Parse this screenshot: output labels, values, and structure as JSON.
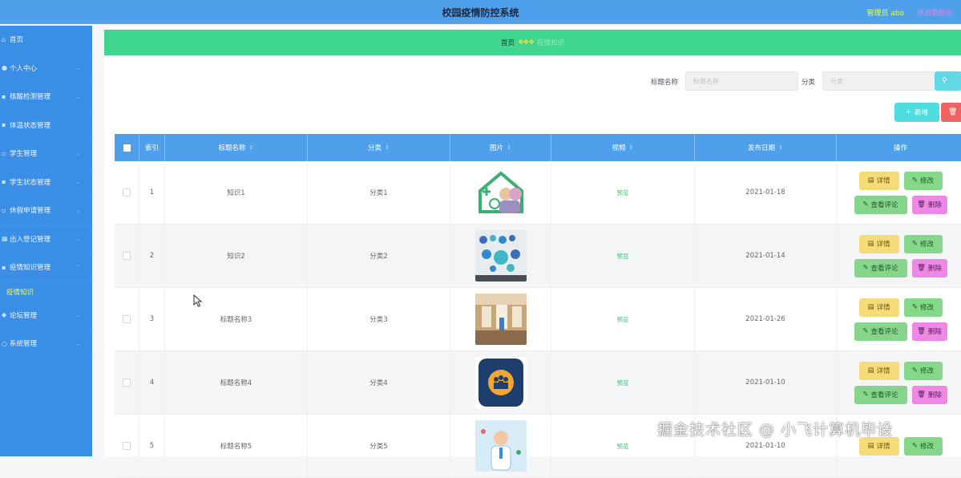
{
  "header": {
    "title": "校园疫情防控系统",
    "admin": "管理员 abo",
    "logout": "退出到前台"
  },
  "sidebar": {
    "items": [
      {
        "label": "首页",
        "icon": "home-icon",
        "expandable": false
      },
      {
        "label": "个人中心",
        "icon": "user-icon",
        "expandable": true
      },
      {
        "label": "核酸检测管理",
        "icon": "flask-icon",
        "expandable": true
      },
      {
        "label": "体温状态管理",
        "icon": "thermometer-icon",
        "expandable": false
      },
      {
        "label": "学生管理",
        "icon": "student-icon",
        "expandable": true
      },
      {
        "label": "学生状态管理",
        "icon": "status-icon",
        "expandable": true
      },
      {
        "label": "休假申请管理",
        "icon": "leave-icon",
        "expandable": true
      },
      {
        "label": "出入登记管理",
        "icon": "grid-icon",
        "expandable": true
      },
      {
        "label": "疫情知识管理",
        "icon": "book-icon",
        "expandable": true
      },
      {
        "label": "疫情知识",
        "icon": "",
        "expandable": false,
        "sub": true
      },
      {
        "label": "论坛管理",
        "icon": "forum-icon",
        "expandable": true
      },
      {
        "label": "系统管理",
        "icon": "gear-icon",
        "expandable": true
      }
    ]
  },
  "breadcrumb": {
    "home": "首页",
    "sep": "❖❖❖",
    "current": "疫情知识"
  },
  "search": {
    "title_label": "标题名称",
    "title_placeholder": "标题名称",
    "category_label": "分类",
    "category_placeholder": "分类",
    "query_icon": "search-icon"
  },
  "actions": {
    "add_label": "新增",
    "add_icon": "plus-icon",
    "delete_icon": "trash-icon"
  },
  "table": {
    "columns": [
      "索引",
      "标题名称",
      "分类",
      "图片",
      "视频",
      "发布日期",
      "操作"
    ],
    "rows": [
      {
        "index": "1",
        "title": "知识1",
        "category": "分类1",
        "image": "house-family-image",
        "video": "预览",
        "date": "2021-01-18"
      },
      {
        "index": "2",
        "title": "知识2",
        "category": "分类2",
        "image": "health-icons-image",
        "video": "预览",
        "date": "2021-01-14"
      },
      {
        "index": "3",
        "title": "标题名称3",
        "category": "分类3",
        "image": "hospital-corridor-image",
        "video": "预览",
        "date": "2021-01-26"
      },
      {
        "index": "4",
        "title": "标题名称4",
        "category": "分类4",
        "image": "group-app-icon-image",
        "video": "预览",
        "date": "2021-01-10"
      },
      {
        "index": "5",
        "title": "标题名称5",
        "category": "分类5",
        "image": "doctor-illustration-image",
        "video": "预览",
        "date": "2021-01-10"
      }
    ],
    "op_labels": {
      "detail": "详情",
      "edit": "修改",
      "comments": "查看评论",
      "delete": "删除"
    }
  },
  "watermark": "掘金技术社区 @ 小飞计算机毕设",
  "colors": {
    "header": "#4ea0ea",
    "sidebar": "#3a8ee6",
    "breadcrumb": "#3fd68f",
    "detail_button": "#f5dc78",
    "edit_button": "#85d88a",
    "delete_button": "#ee88e6",
    "add_button": "#4fdde0",
    "batch_delete_button": "#f06363"
  }
}
